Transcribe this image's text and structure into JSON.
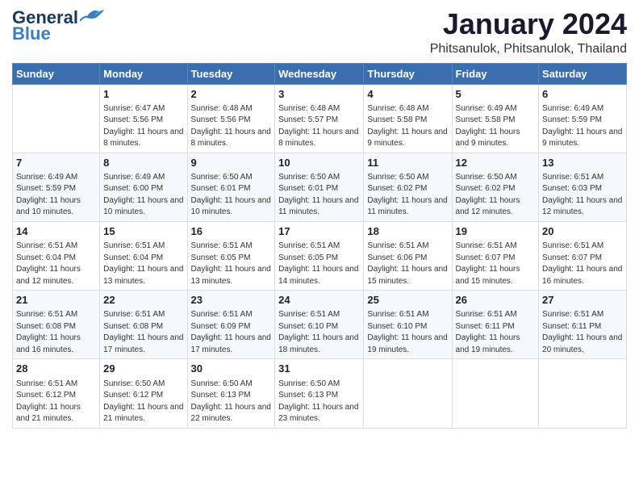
{
  "logo": {
    "line1": "General",
    "line2": "Blue",
    "accent": "Blue"
  },
  "header": {
    "month": "January 2024",
    "location": "Phitsanulok, Phitsanulok, Thailand"
  },
  "weekdays": [
    "Sunday",
    "Monday",
    "Tuesday",
    "Wednesday",
    "Thursday",
    "Friday",
    "Saturday"
  ],
  "weeks": [
    [
      null,
      {
        "day": 1,
        "sunrise": "6:47 AM",
        "sunset": "5:56 PM",
        "daylight": "11 hours and 8 minutes."
      },
      {
        "day": 2,
        "sunrise": "6:48 AM",
        "sunset": "5:56 PM",
        "daylight": "11 hours and 8 minutes."
      },
      {
        "day": 3,
        "sunrise": "6:48 AM",
        "sunset": "5:57 PM",
        "daylight": "11 hours and 8 minutes."
      },
      {
        "day": 4,
        "sunrise": "6:48 AM",
        "sunset": "5:58 PM",
        "daylight": "11 hours and 9 minutes."
      },
      {
        "day": 5,
        "sunrise": "6:49 AM",
        "sunset": "5:58 PM",
        "daylight": "11 hours and 9 minutes."
      },
      {
        "day": 6,
        "sunrise": "6:49 AM",
        "sunset": "5:59 PM",
        "daylight": "11 hours and 9 minutes."
      }
    ],
    [
      {
        "day": 7,
        "sunrise": "6:49 AM",
        "sunset": "5:59 PM",
        "daylight": "11 hours and 10 minutes."
      },
      {
        "day": 8,
        "sunrise": "6:49 AM",
        "sunset": "6:00 PM",
        "daylight": "11 hours and 10 minutes."
      },
      {
        "day": 9,
        "sunrise": "6:50 AM",
        "sunset": "6:01 PM",
        "daylight": "11 hours and 10 minutes."
      },
      {
        "day": 10,
        "sunrise": "6:50 AM",
        "sunset": "6:01 PM",
        "daylight": "11 hours and 11 minutes."
      },
      {
        "day": 11,
        "sunrise": "6:50 AM",
        "sunset": "6:02 PM",
        "daylight": "11 hours and 11 minutes."
      },
      {
        "day": 12,
        "sunrise": "6:50 AM",
        "sunset": "6:02 PM",
        "daylight": "11 hours and 12 minutes."
      },
      {
        "day": 13,
        "sunrise": "6:51 AM",
        "sunset": "6:03 PM",
        "daylight": "11 hours and 12 minutes."
      }
    ],
    [
      {
        "day": 14,
        "sunrise": "6:51 AM",
        "sunset": "6:04 PM",
        "daylight": "11 hours and 12 minutes."
      },
      {
        "day": 15,
        "sunrise": "6:51 AM",
        "sunset": "6:04 PM",
        "daylight": "11 hours and 13 minutes."
      },
      {
        "day": 16,
        "sunrise": "6:51 AM",
        "sunset": "6:05 PM",
        "daylight": "11 hours and 13 minutes."
      },
      {
        "day": 17,
        "sunrise": "6:51 AM",
        "sunset": "6:05 PM",
        "daylight": "11 hours and 14 minutes."
      },
      {
        "day": 18,
        "sunrise": "6:51 AM",
        "sunset": "6:06 PM",
        "daylight": "11 hours and 15 minutes."
      },
      {
        "day": 19,
        "sunrise": "6:51 AM",
        "sunset": "6:07 PM",
        "daylight": "11 hours and 15 minutes."
      },
      {
        "day": 20,
        "sunrise": "6:51 AM",
        "sunset": "6:07 PM",
        "daylight": "11 hours and 16 minutes."
      }
    ],
    [
      {
        "day": 21,
        "sunrise": "6:51 AM",
        "sunset": "6:08 PM",
        "daylight": "11 hours and 16 minutes."
      },
      {
        "day": 22,
        "sunrise": "6:51 AM",
        "sunset": "6:08 PM",
        "daylight": "11 hours and 17 minutes."
      },
      {
        "day": 23,
        "sunrise": "6:51 AM",
        "sunset": "6:09 PM",
        "daylight": "11 hours and 17 minutes."
      },
      {
        "day": 24,
        "sunrise": "6:51 AM",
        "sunset": "6:10 PM",
        "daylight": "11 hours and 18 minutes."
      },
      {
        "day": 25,
        "sunrise": "6:51 AM",
        "sunset": "6:10 PM",
        "daylight": "11 hours and 19 minutes."
      },
      {
        "day": 26,
        "sunrise": "6:51 AM",
        "sunset": "6:11 PM",
        "daylight": "11 hours and 19 minutes."
      },
      {
        "day": 27,
        "sunrise": "6:51 AM",
        "sunset": "6:11 PM",
        "daylight": "11 hours and 20 minutes."
      }
    ],
    [
      {
        "day": 28,
        "sunrise": "6:51 AM",
        "sunset": "6:12 PM",
        "daylight": "11 hours and 21 minutes."
      },
      {
        "day": 29,
        "sunrise": "6:50 AM",
        "sunset": "6:12 PM",
        "daylight": "11 hours and 21 minutes."
      },
      {
        "day": 30,
        "sunrise": "6:50 AM",
        "sunset": "6:13 PM",
        "daylight": "11 hours and 22 minutes."
      },
      {
        "day": 31,
        "sunrise": "6:50 AM",
        "sunset": "6:13 PM",
        "daylight": "11 hours and 23 minutes."
      },
      null,
      null,
      null
    ]
  ],
  "labels": {
    "sunrise_prefix": "Sunrise: ",
    "sunset_prefix": "Sunset: ",
    "daylight_prefix": "Daylight: "
  }
}
